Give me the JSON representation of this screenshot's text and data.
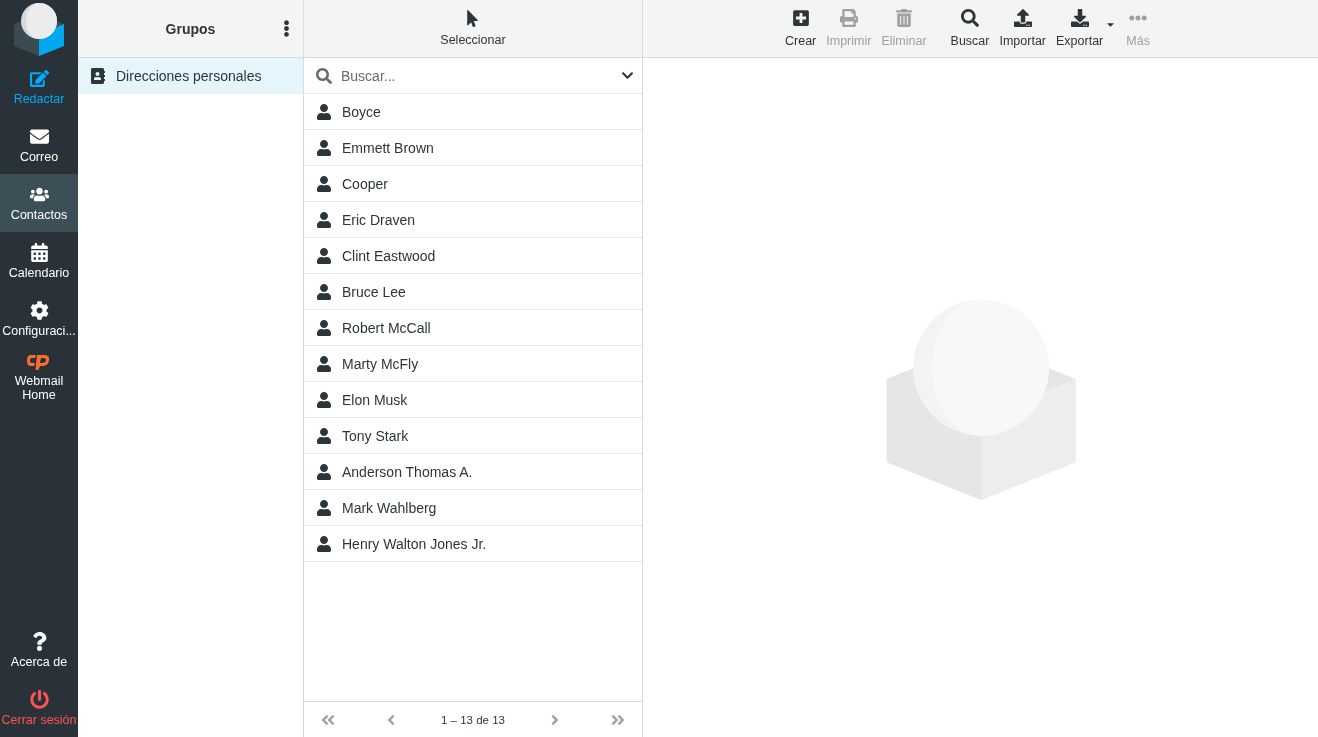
{
  "nav": {
    "items": [
      {
        "kind": "compose",
        "label": "Redactar",
        "selected": false
      },
      {
        "kind": "mail",
        "label": "Correo",
        "selected": false
      },
      {
        "kind": "contacts",
        "label": "Contactos",
        "selected": true
      },
      {
        "kind": "calendar",
        "label": "Calendario",
        "selected": false
      },
      {
        "kind": "settings",
        "label": "Configuraci...",
        "selected": false
      },
      {
        "kind": "cpanel",
        "label": "Webmail Home",
        "selected": false
      }
    ],
    "footer_items": [
      {
        "kind": "about",
        "label": "Acerca de",
        "selected": false
      },
      {
        "kind": "logout",
        "label": "Cerrar sesión",
        "selected": false
      }
    ]
  },
  "groups": {
    "title": "Grupos",
    "items": [
      {
        "label": "Direcciones personales",
        "selected": true
      }
    ]
  },
  "list_toolbar": {
    "label": "Seleccionar"
  },
  "toolbar": {
    "buttons": [
      {
        "kind": "create",
        "label": "Crear",
        "disabled": false
      },
      {
        "kind": "print",
        "label": "Imprimir",
        "disabled": true
      },
      {
        "kind": "delete",
        "label": "Eliminar",
        "disabled": true
      },
      {
        "kind": "search",
        "label": "Buscar",
        "disabled": false
      },
      {
        "kind": "import",
        "label": "Importar",
        "disabled": false
      },
      {
        "kind": "export",
        "label": "Exportar",
        "disabled": false,
        "has_menu": true
      },
      {
        "kind": "more",
        "label": "Más",
        "disabled": true
      }
    ]
  },
  "search": {
    "placeholder": "Buscar..."
  },
  "contacts": [
    {
      "name": "Boyce"
    },
    {
      "name": "Emmett Brown"
    },
    {
      "name": "Cooper"
    },
    {
      "name": "Eric Draven"
    },
    {
      "name": "Clint Eastwood"
    },
    {
      "name": "Bruce Lee"
    },
    {
      "name": "Robert McCall"
    },
    {
      "name": "Marty McFly"
    },
    {
      "name": "Elon Musk"
    },
    {
      "name": "Tony Stark"
    },
    {
      "name": "Anderson Thomas A."
    },
    {
      "name": "Mark Wahlberg"
    },
    {
      "name": "Henry Walton Jones Jr."
    }
  ],
  "pager": {
    "text": "1 – 13 de 13",
    "buttons": [
      {
        "kind": "first",
        "disabled": true
      },
      {
        "kind": "prev",
        "disabled": true
      },
      {
        "kind": "next",
        "disabled": true
      },
      {
        "kind": "last",
        "disabled": true
      }
    ]
  }
}
